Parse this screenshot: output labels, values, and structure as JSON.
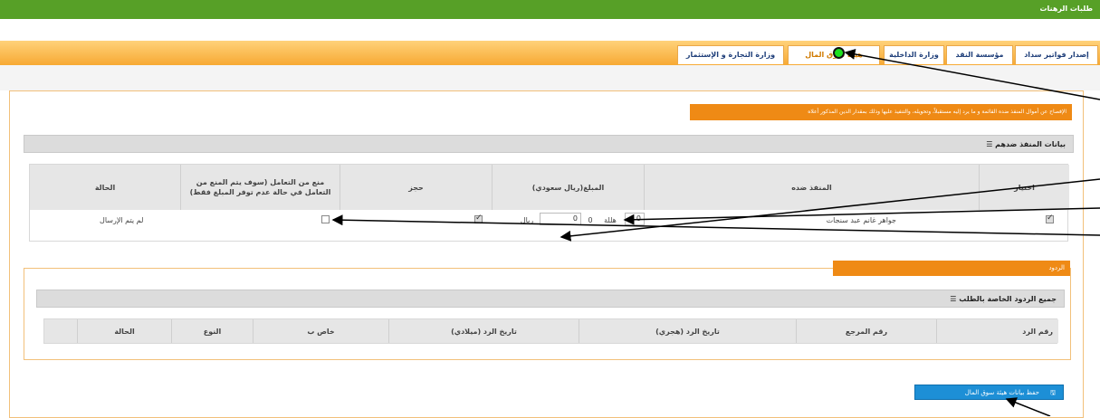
{
  "app": {
    "title": "طلبات الرهنات"
  },
  "tabs": [
    {
      "label": "إصدار فواتير سداد"
    },
    {
      "label": "مؤسسة النقد"
    },
    {
      "label": "وزارة الداخلية"
    },
    {
      "label": "هيئة سوق المال"
    },
    {
      "label": "وزارة التجارة و الإستثمار"
    }
  ],
  "notice": {
    "text": "الإفصاح عن أموال المنفذ ضده القائمة و ما يرد إليه مستقبلاً، وتحويله، والتنفيذ عليها وذلك بمقدار الدين المذكور أعلاه"
  },
  "section1": {
    "title": "☰ بيانات المنفذ ضدهم",
    "columns": [
      "اختيار",
      "المنفذ ضده",
      "المبلغ(ريال سعودي)",
      "حجز",
      "منع من التعامل (سوف يتم المنع من التعامل في حالة عدم توفر المبلغ فقط)",
      "الحالة"
    ],
    "row": {
      "selected": true,
      "name": "جواهر غانم عبد سنجات",
      "amount_riyal": "0",
      "riyal_label": "ريال",
      "amount_halala": "0",
      "halala_label": "هللة",
      "riyal_box": "0",
      "seize": true,
      "prevent": false,
      "status": "لم يتم الإرسال"
    }
  },
  "responses": {
    "label": "الردود",
    "title": "☰ جميع الردود الخاصة بالطلب",
    "columns": [
      "رقم الرد",
      "رقم المرجع",
      "تاريخ الرد (هجري)",
      "تاريخ الرد (ميلادي)",
      "خاص ب",
      "النوع",
      "الحالة"
    ]
  },
  "save_button": {
    "label": "حفظ بيانات هيئة سوق المال",
    "icon": "save-icon"
  },
  "colors": {
    "green": "#57a027",
    "orange": "#ef8a15",
    "blue": "#1d8fd6"
  }
}
